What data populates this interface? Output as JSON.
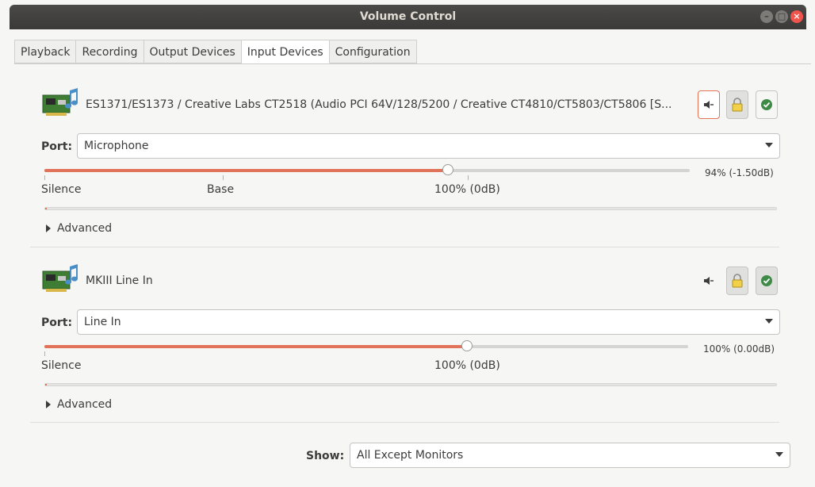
{
  "window": {
    "title": "Volume Control"
  },
  "tabs": [
    {
      "label": "Playback",
      "active": false
    },
    {
      "label": "Recording",
      "active": false
    },
    {
      "label": "Output Devices",
      "active": false
    },
    {
      "label": "Input Devices",
      "active": true
    },
    {
      "label": "Configuration",
      "active": false
    }
  ],
  "devices": [
    {
      "name": "ES1371/ES1373 / Creative Labs CT2518 (Audio PCI 64V/128/5200 / Creative CT4810/CT5803/CT5806 [S...",
      "port_label": "Port:",
      "port_value": "Microphone",
      "volume_fraction": 0.625,
      "volume_text": "94% (-1.50dB)",
      "marks": {
        "silence": "Silence",
        "base": "Base",
        "hundred": "100% (0dB)"
      },
      "meter_level": 0.002,
      "advanced_label": "Advanced",
      "icons": [
        "speaker-mute-icon",
        "lock-icon",
        "default-check-icon"
      ]
    },
    {
      "name": "MKIII Line In",
      "port_label": "Port:",
      "port_value": "Line In",
      "volume_fraction": 0.656,
      "volume_text": "100% (0.00dB)",
      "marks": {
        "silence": "Silence",
        "hundred": "100% (0dB)"
      },
      "meter_level": 0.002,
      "advanced_label": "Advanced",
      "icons": [
        "speaker-mute-icon",
        "lock-icon",
        "default-check-icon"
      ]
    }
  ],
  "footer": {
    "show_label": "Show:",
    "show_value": "All Except Monitors"
  },
  "colors": {
    "accent": "#e0735a",
    "titlebar": "#3b3a38",
    "close": "#f0544c",
    "check": "#3f8a47"
  }
}
